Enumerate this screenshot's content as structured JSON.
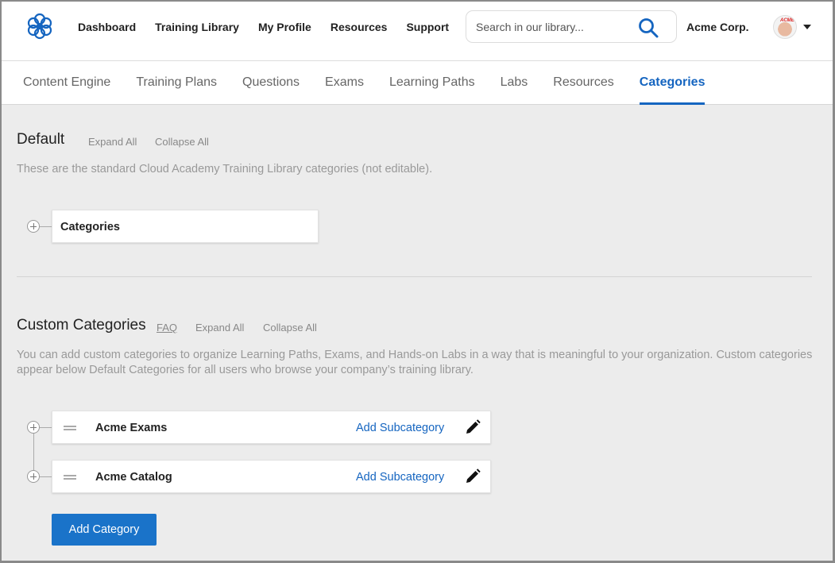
{
  "header": {
    "nav": [
      "Dashboard",
      "Training Library",
      "My Profile",
      "Resources",
      "Support"
    ],
    "search_placeholder": "Search in our library...",
    "org_name": "Acme Corp.",
    "avatar_text": "ACME"
  },
  "subnav": {
    "tabs": [
      "Content Engine",
      "Training Plans",
      "Questions",
      "Exams",
      "Learning Paths",
      "Labs",
      "Resources",
      "Categories"
    ],
    "active": "Categories"
  },
  "default_section": {
    "title": "Default",
    "expand_all": "Expand All",
    "collapse_all": "Collapse All",
    "description": "These are the standard Cloud Academy Training Library categories (not editable).",
    "items": [
      {
        "label": "Categories"
      }
    ]
  },
  "custom_section": {
    "title": "Custom Categories",
    "faq": "FAQ",
    "expand_all": "Expand All",
    "collapse_all": "Collapse All",
    "description": "You can add custom categories to organize Learning Paths, Exams, and Hands-on Labs in a way that is meaningful to your organization. Custom categories appear below Default Categories for all users who browse your company’s training library.",
    "items": [
      {
        "label": "Acme Exams",
        "action": "Add Subcategory"
      },
      {
        "label": "Acme Catalog",
        "action": "Add Subcategory"
      }
    ],
    "add_button": "Add Category"
  },
  "colors": {
    "accent": "#1565c0",
    "button": "#1a73c9",
    "background": "#ececec"
  },
  "icons": {
    "logo": "flower-logo-icon",
    "search": "search-icon",
    "expand": "plus-circle-icon",
    "drag": "drag-handle-icon",
    "edit": "pencil-icon",
    "menu": "caret-down-icon"
  }
}
